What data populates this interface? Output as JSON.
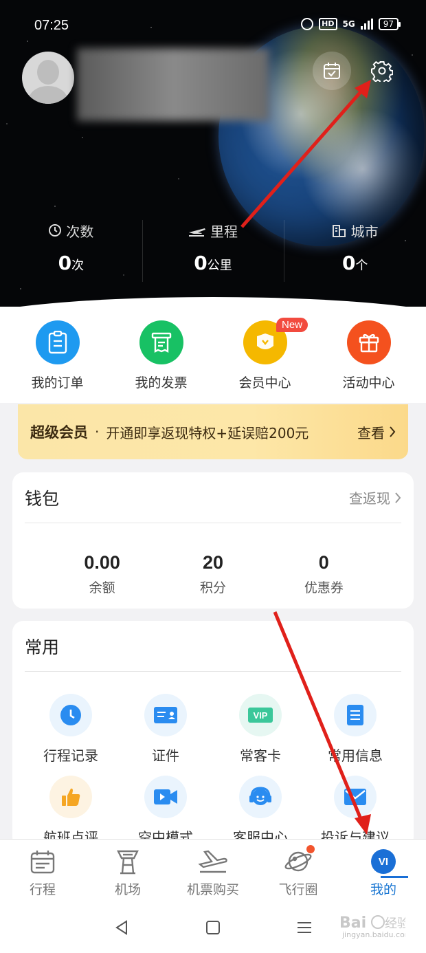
{
  "status_bar": {
    "time": "07:25",
    "hd": "HD",
    "signal": "5G",
    "battery": "97"
  },
  "header": {
    "stats": [
      {
        "label": "次数",
        "value": "0",
        "unit": "次",
        "icon": "clock-icon"
      },
      {
        "label": "里程",
        "value": "0",
        "unit": "公里",
        "icon": "plane-icon"
      },
      {
        "label": "城市",
        "value": "0",
        "unit": "个",
        "icon": "building-icon"
      }
    ]
  },
  "quick_actions": [
    {
      "label": "我的订单",
      "icon": "order-icon",
      "color": "#1e9af0"
    },
    {
      "label": "我的发票",
      "icon": "invoice-icon",
      "color": "#18c164"
    },
    {
      "label": "会员中心",
      "icon": "member-icon",
      "color": "#f5b800",
      "badge": "New"
    },
    {
      "label": "活动中心",
      "icon": "gift-icon",
      "color": "#f4511e"
    }
  ],
  "banner": {
    "title": "超级会员",
    "separator": "·",
    "desc": "开通即享返现特权+延误赔200元",
    "link": "查看"
  },
  "wallet": {
    "title": "钱包",
    "link": "查返现",
    "items": [
      {
        "value": "0.00",
        "label": "余额"
      },
      {
        "value": "20",
        "label": "积分"
      },
      {
        "value": "0",
        "label": "优惠券"
      }
    ]
  },
  "common": {
    "title": "常用",
    "items": [
      {
        "label": "行程记录",
        "icon": "history-clock-icon"
      },
      {
        "label": "证件",
        "icon": "id-card-icon"
      },
      {
        "label": "常客卡",
        "icon": "vip-card-icon"
      },
      {
        "label": "常用信息",
        "icon": "document-list-icon"
      },
      {
        "label": "航班点评",
        "icon": "thumbs-up-icon"
      },
      {
        "label": "空中模式",
        "icon": "video-icon"
      },
      {
        "label": "客服中心",
        "icon": "headset-icon"
      },
      {
        "label": "投诉与建议",
        "icon": "mail-icon"
      }
    ]
  },
  "bottom_nav": [
    {
      "label": "行程",
      "icon": "itinerary-icon"
    },
    {
      "label": "机场",
      "icon": "airport-tower-icon"
    },
    {
      "label": "机票购买",
      "icon": "plane-ticket-icon"
    },
    {
      "label": "飞行圈",
      "icon": "planet-icon"
    },
    {
      "label": "我的",
      "icon": "me-avatar-icon",
      "active": true,
      "badge_text": "VI"
    }
  ],
  "colors": {
    "accent": "#1a6fd6",
    "arrow": "#e0201a"
  }
}
